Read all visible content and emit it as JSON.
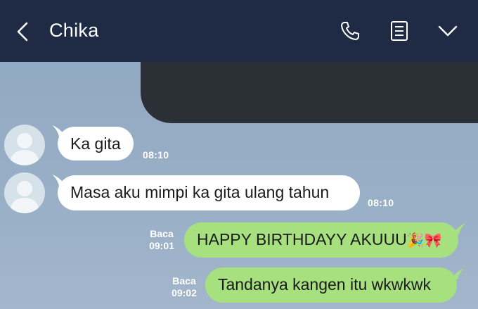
{
  "header": {
    "title": "Chika",
    "back_icon": "chevron-left-icon",
    "call_icon": "phone-icon",
    "notes_icon": "notes-icon",
    "menu_icon": "chevron-down-icon"
  },
  "messages": [
    {
      "direction": "incoming",
      "text": "Ka gita",
      "time": "08:10"
    },
    {
      "direction": "incoming",
      "text": "Masa aku mimpi ka gita ulang tahun",
      "time": "08:10"
    },
    {
      "direction": "outgoing",
      "text": "HAPPY BIRTHDAYY AKUUU",
      "emoji": "🎉🎀",
      "status": "Baca",
      "time": "09:01"
    },
    {
      "direction": "outgoing",
      "text": "Tandanya kangen itu wkwkwk",
      "status": "Baca",
      "time": "09:02"
    }
  ],
  "colors": {
    "header_bg": "#1f2a45",
    "incoming_bubble": "#ffffff",
    "outgoing_bubble": "#a6e07f",
    "redacted_block": "#2a3036"
  }
}
